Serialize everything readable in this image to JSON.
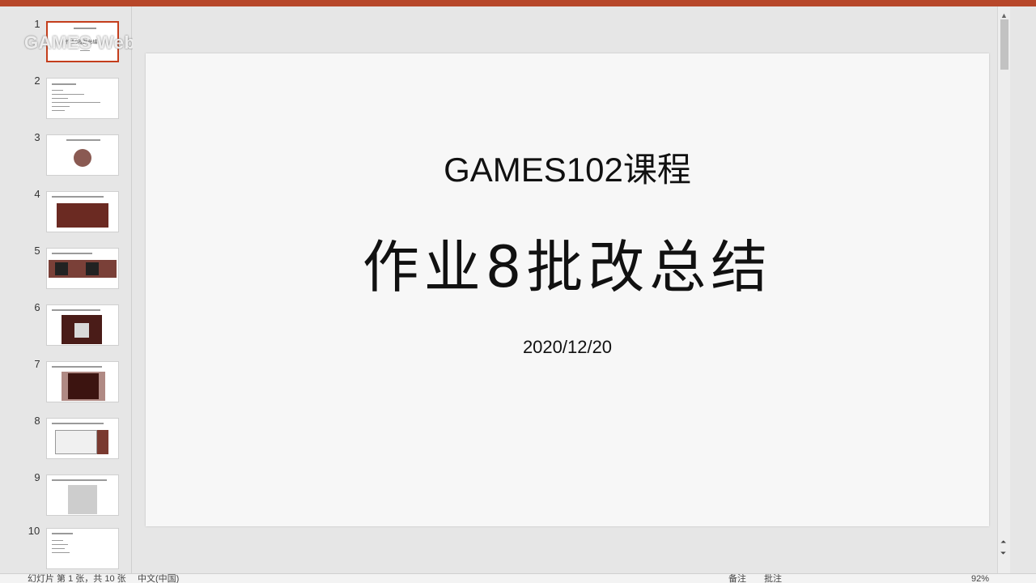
{
  "watermark": "GAMES Webinar",
  "thumbnails": [
    {
      "num": "1",
      "caption": "作业8批改总结"
    },
    {
      "num": "2",
      "caption": ""
    },
    {
      "num": "3",
      "caption": ""
    },
    {
      "num": "4",
      "caption": ""
    },
    {
      "num": "5",
      "caption": ""
    },
    {
      "num": "6",
      "caption": ""
    },
    {
      "num": "7",
      "caption": ""
    },
    {
      "num": "8",
      "caption": ""
    },
    {
      "num": "9",
      "caption": ""
    },
    {
      "num": "10",
      "caption": ""
    }
  ],
  "slide": {
    "course": "GAMES102课程",
    "title": "作业8批改总结",
    "date": "2020/12/20"
  },
  "status": {
    "slide_info": "幻灯片 第 1 张，共 10 张",
    "language": "中文(中国)",
    "notes": "备注",
    "comments": "批注",
    "zoom": "92%"
  },
  "colors": {
    "accent": "#b7472a",
    "selected_border": "#c43e1c"
  }
}
